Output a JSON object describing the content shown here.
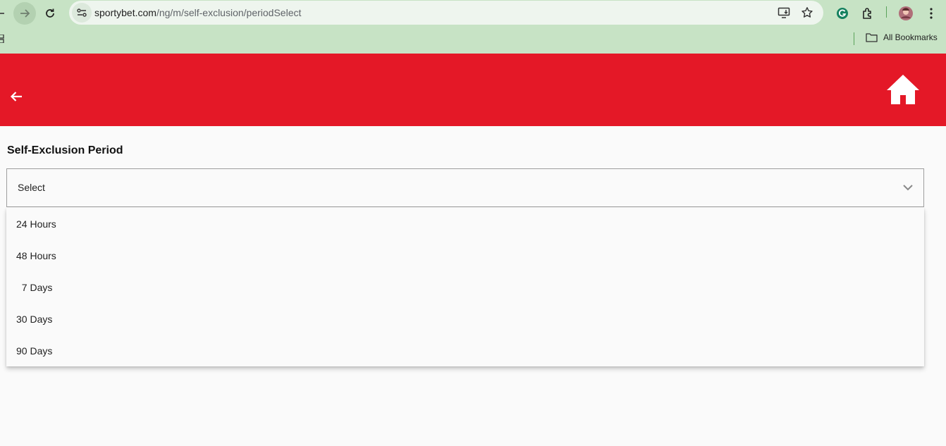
{
  "browser": {
    "url_domain": "sportybet.com",
    "url_path": "/ng/m/self-exclusion/periodSelect",
    "all_bookmarks_label": "All Bookmarks",
    "icons": [
      "back-arrow-icon",
      "forward-arrow-icon",
      "reload-icon",
      "site-info-icon",
      "install-app-icon",
      "star-icon",
      "grammarly-icon",
      "extensions-icon",
      "profile-avatar",
      "kebab-menu-icon",
      "folder-icon"
    ]
  },
  "header": {
    "background_color": "#e41827",
    "back_icon": "arrow-left-icon",
    "home_icon": "home-icon"
  },
  "form": {
    "title": "Self-Exclusion Period",
    "select_value": "Select",
    "options": [
      "24 Hours",
      "48 Hours",
      "  7 Days",
      "30 Days",
      "90 Days"
    ]
  }
}
